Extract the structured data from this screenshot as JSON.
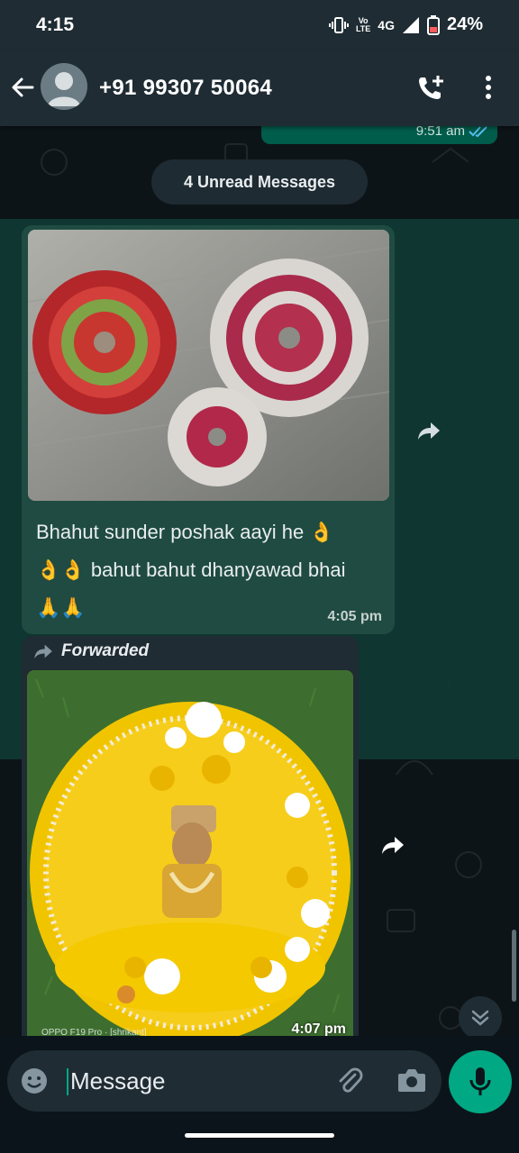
{
  "status_bar": {
    "time": "4:15",
    "network_top": "Vo",
    "network_bottom": "LTE",
    "network_type": "4G",
    "battery": "24%"
  },
  "header": {
    "contact_name": "+91 99307 50064",
    "icons": [
      "back-arrow-icon",
      "avatar",
      "add-call-icon",
      "more-options-icon"
    ]
  },
  "chat": {
    "previous_message_time": "9:51 am",
    "unread_label": "4 Unread Messages",
    "messages": [
      {
        "type": "image-with-caption",
        "image_alt": "decorative flower poshak garments",
        "text_line1": "Bhahut sunder poshak aayi he 👌",
        "text_line2": "👌👌 bahut bahut dhanyawad bhai",
        "text_line3": "🙏🙏",
        "time": "4:05 pm"
      },
      {
        "type": "forwarded-image",
        "forwarded_label": "Forwarded",
        "image_alt": "yellow decorated deity dress",
        "watermark": "OPPO F19 Pro · [shrikant]",
        "time": "4:07 pm"
      }
    ]
  },
  "input": {
    "placeholder": "Message"
  },
  "colors": {
    "header_bg": "#1f2c34",
    "accent": "#00a884",
    "outgoing_bubble": "#005c4b",
    "incoming_bubble": "#1f2c34"
  }
}
